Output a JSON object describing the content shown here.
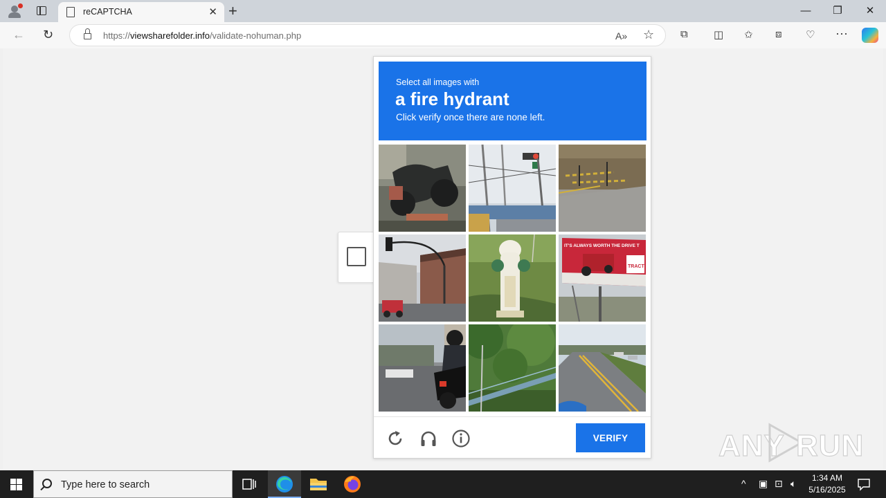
{
  "browser": {
    "tab_title": "reCAPTCHA",
    "url_scheme": "https://",
    "url_host": "viewsharefolder.info",
    "url_path": "/validate-nohuman.php"
  },
  "captcha": {
    "instruction_small": "Select all images with",
    "instruction_target": "a fire hydrant",
    "instruction_note": "Click verify once there are none left.",
    "verify_label": "VERIFY",
    "tiles": [
      {
        "icon": "motorcycle-tile"
      },
      {
        "icon": "traffic-light-poles-tile"
      },
      {
        "icon": "road-barrier-tile"
      },
      {
        "icon": "street-traffic-light-tile"
      },
      {
        "icon": "fire-hydrant-tile"
      },
      {
        "icon": "billboard-tile"
      },
      {
        "icon": "motorcyclist-tile"
      },
      {
        "icon": "bridge-trees-tile"
      },
      {
        "icon": "highway-tile"
      }
    ],
    "billboard_text": "IT'S ALWAYS WORTH THE DRIVE T",
    "billboard_brand": "TRACT"
  },
  "watermark": {
    "left": "ANY",
    "right": "RUN"
  },
  "taskbar": {
    "search_placeholder": "Type here to search",
    "time": "1:34 AM",
    "date": "5/16/2025"
  },
  "colors": {
    "accent": "#1a73e8",
    "taskbar": "#1f1f1f"
  }
}
